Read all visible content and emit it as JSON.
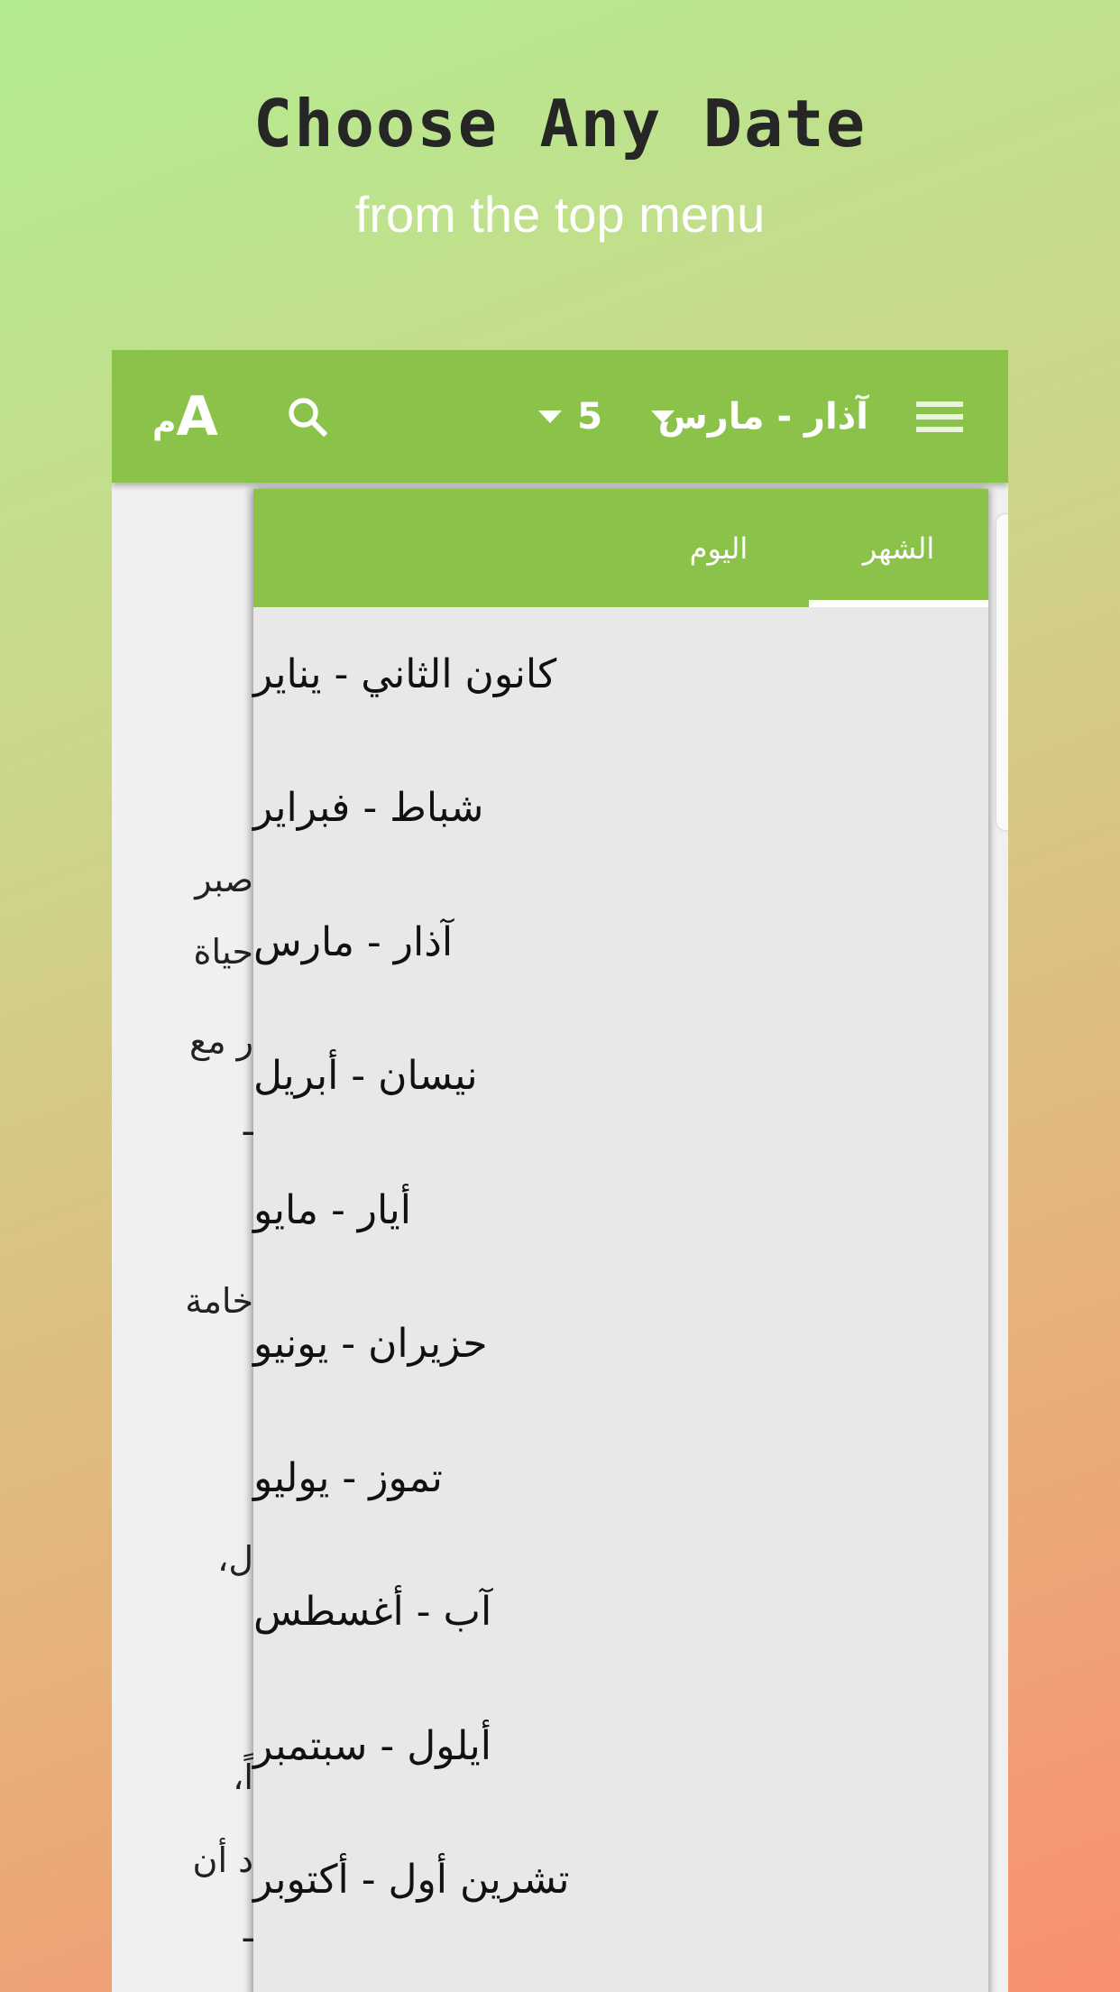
{
  "header": {
    "title": "Choose Any Date",
    "subtitle": "from the top menu"
  },
  "appbar": {
    "month": "آذار - مارس",
    "day": "5",
    "font_icon": "ﻡA",
    "icons": [
      "menu-icon",
      "dropdown-arrow-icon",
      "search-icon",
      "font-size-icon"
    ],
    "color": "#8bc34a"
  },
  "background_fragments": [
    "صبر",
    "حياة",
    "ر مع",
    "ـ",
    "خامة",
    "ل،",
    "اً،",
    "د أن",
    "ـ"
  ],
  "dropdown": {
    "tabs": [
      {
        "label": "الشهر",
        "active": true
      },
      {
        "label": "اليوم",
        "active": false
      }
    ],
    "months": [
      "كانون الثاني - يناير",
      "شباط - فبراير",
      "آذار - مارس",
      "نيسان - أبريل",
      "أيار - مايو",
      "حزيران - يونيو",
      "تموز - يوليو",
      "آب - أغسطس",
      "أيلول - سبتمبر",
      "تشرين أول - أكتوبر"
    ]
  }
}
